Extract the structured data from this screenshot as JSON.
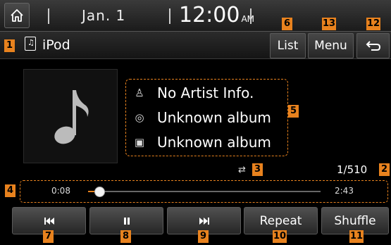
{
  "status_bar": {
    "date": "Jan.  1",
    "time": "12:00",
    "ampm": "AM"
  },
  "source": {
    "icon": "music-file-icon",
    "label": "iPod"
  },
  "top_buttons": {
    "list": "List",
    "menu": "Menu",
    "back_icon": "back-arrow-icon"
  },
  "track_info": {
    "artist": "No Artist Info.",
    "album": "Unknown album",
    "title": "Unknown album",
    "artist_icon": "person-icon",
    "album_icon": "album-disc-icon",
    "title_icon": "music-file-icon"
  },
  "track_count": "1/510",
  "repeat_icon": "repeat-mode-icon",
  "progress": {
    "elapsed": "0:08",
    "total": "2:43",
    "fraction": 0.049
  },
  "bottom_buttons": {
    "prev_icon": "previous-track-icon",
    "pause_icon": "pause-icon",
    "next_icon": "next-track-icon",
    "repeat": "Repeat",
    "shuffle": "Shuffle"
  },
  "badges": [
    "1",
    "2",
    "3",
    "4",
    "5",
    "6",
    "7",
    "8",
    "9",
    "10",
    "11",
    "12",
    "13"
  ],
  "colors": {
    "accent": "#e8821e",
    "background": "#000000"
  }
}
